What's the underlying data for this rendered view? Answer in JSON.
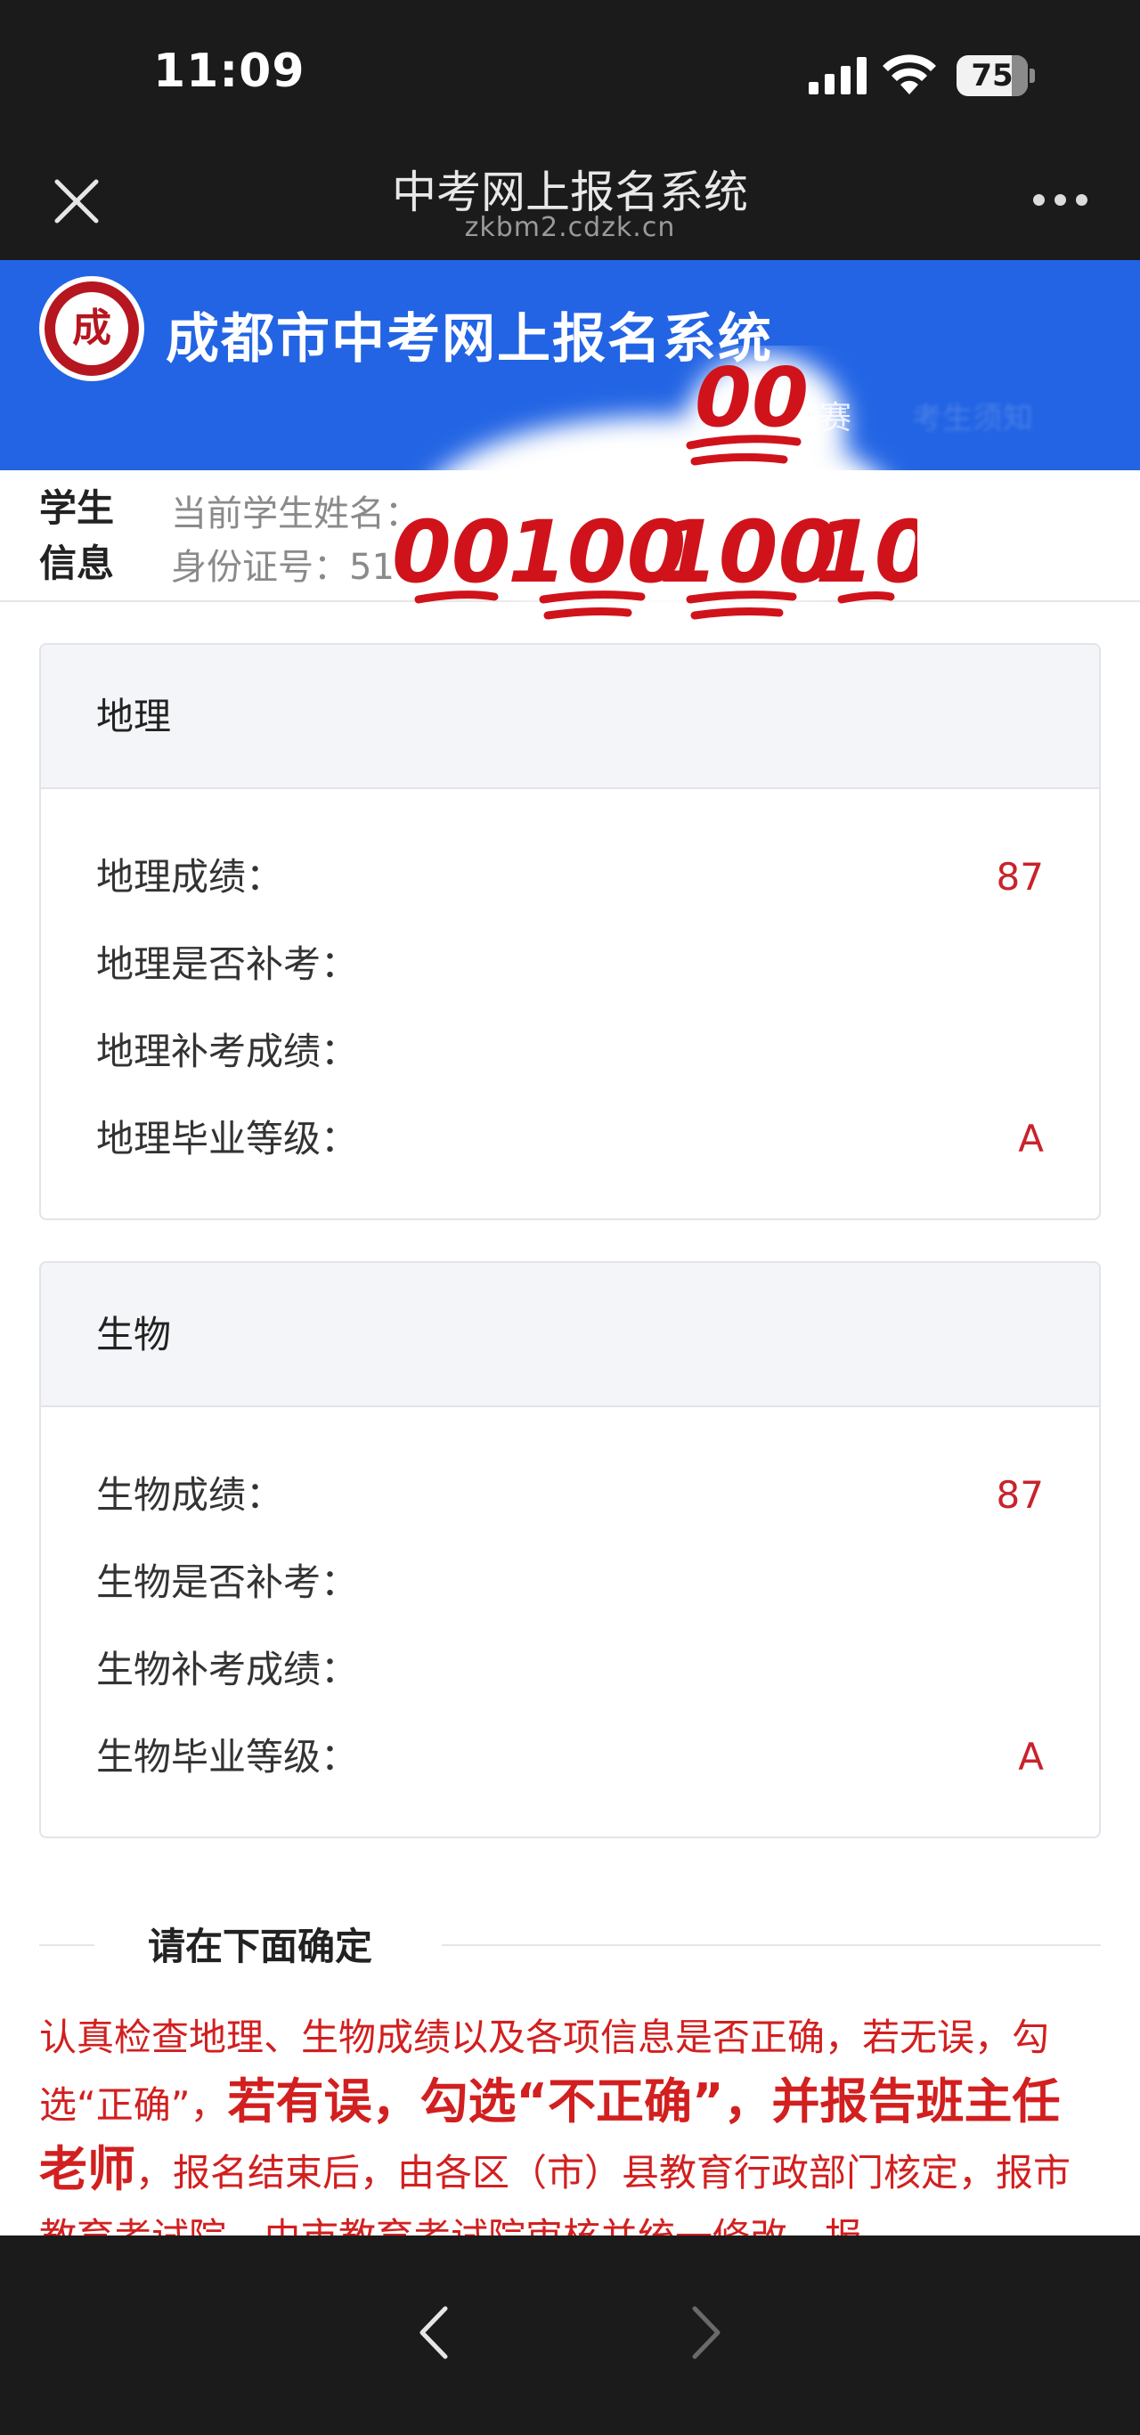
{
  "status_bar": {
    "time": "11:09",
    "battery": "75"
  },
  "nav": {
    "title": "中考网上报名系统",
    "url": "zkbm2.cdzk.cn"
  },
  "site": {
    "title": "成都市中考网上报名系统",
    "tab_partial": "赛",
    "tab_blurred": "考生须知"
  },
  "student": {
    "label": "学生信息",
    "name_line": "当前学生姓名：",
    "id_line": "身份证号：51"
  },
  "overlay": {
    "emoji": "💯",
    "text": "100"
  },
  "geography": {
    "header": "地理",
    "rows": [
      {
        "label": "地理成绩：",
        "value": "87"
      },
      {
        "label": "地理是否补考：",
        "value": ""
      },
      {
        "label": "地理补考成绩：",
        "value": ""
      },
      {
        "label": "地理毕业等级：",
        "value": "A"
      }
    ]
  },
  "biology": {
    "header": "生物",
    "rows": [
      {
        "label": "生物成绩：",
        "value": "87"
      },
      {
        "label": "生物是否补考：",
        "value": ""
      },
      {
        "label": "生物补考成绩：",
        "value": ""
      },
      {
        "label": "生物毕业等级：",
        "value": "A"
      }
    ]
  },
  "confirm": {
    "title": "请在下面确定",
    "p1": "认真检查地理、生物成绩以及各项信息是否正确，若无误，勾选“正确”，",
    "p1_bold": "若有误，勾选“不正确”，并报告班主任老师",
    "p2": "，报名结束后，由各区（市）县教育行政部门核定，报市教育考试院，由市教育考试院审核并统一修改。报"
  },
  "colors": {
    "brand_blue": "#2264e4",
    "score_red": "#c8232c",
    "notice_red": "#d21f1f",
    "chrome": "#1b1b1b"
  }
}
